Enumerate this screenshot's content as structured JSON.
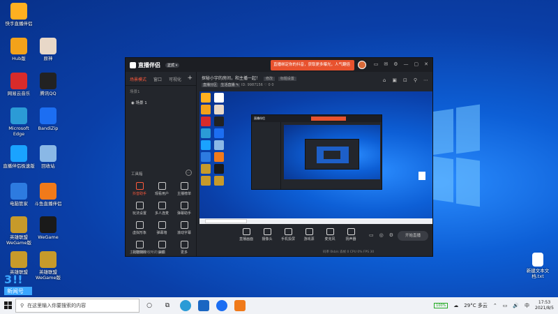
{
  "desktop": {
    "icons": [
      {
        "label": "快手直播伴侣",
        "color": "#ffb020"
      },
      {
        "label": "Hub版",
        "color": "#f3a21a"
      },
      {
        "label": "原神",
        "color": "#e8d8c8"
      },
      {
        "label": "网易云音乐",
        "color": "#d82b2b"
      },
      {
        "label": "腾讯QQ",
        "color": "#222222"
      },
      {
        "label": "Microsoft Edge",
        "color": "#2b9bd6"
      },
      {
        "label": "BandiZip",
        "color": "#1c6ef2"
      },
      {
        "label": "直播伴侣极速版",
        "color": "#1aa3ff"
      },
      {
        "label": "回收站",
        "color": "#8ab8e6"
      },
      {
        "label": "电脑管家",
        "color": "#2d7be0"
      },
      {
        "label": "斗鱼直播伴侣",
        "color": "#f07a1a"
      },
      {
        "label": "英雄联盟WeGame版",
        "color": "#c79a2a"
      },
      {
        "label": "WeGame",
        "color": "#1a1a1a"
      },
      {
        "label": "英雄联盟",
        "color": "#c79a2a"
      },
      {
        "label": "英雄联盟WeGame版",
        "color": "#c79a2a"
      }
    ],
    "right_file": {
      "label": "新建文本文档.txt"
    },
    "watermark_text": "新闻号"
  },
  "app": {
    "brand": "直播伴侣",
    "version": "正式 ▾",
    "banner": "直播绑定你的抖音，获取更多曝光，人气翻倍",
    "window_controls": [
      "▭",
      "✉",
      "⚙",
      "—",
      "▢",
      "✕"
    ],
    "sidebar": {
      "tabs": [
        "场景模式",
        "窗口",
        "可视化"
      ],
      "plus": "+",
      "scene_hint": "场景1",
      "scene_item": "◉ 场景 1",
      "tools_header": "工具箱",
      "tools": [
        {
          "label": "抖音助手",
          "red": true
        },
        {
          "label": "观看用户",
          "red": false
        },
        {
          "label": "主播榜单",
          "red": false
        },
        {
          "label": "玩法设置",
          "red": false
        },
        {
          "label": "多人连麦",
          "red": false
        },
        {
          "label": "弹幕助手",
          "red": false
        },
        {
          "label": "虚拟形象",
          "red": false
        },
        {
          "label": "弹幕墙",
          "red": false
        },
        {
          "label": "滚动字幕",
          "red": false
        },
        {
          "label": "礼物特效",
          "red": false
        },
        {
          "label": "美颜",
          "red": false
        },
        {
          "label": "更多",
          "red": false
        }
      ],
      "footer": "主播直播中收听的音频"
    },
    "live": {
      "title": "探秘小宇的房间，和主播一起！",
      "title_tag": "修改",
      "title_tag2": "标题设置",
      "meta_chip1": "直播分区",
      "meta_chip2": "生活直播 ✎",
      "meta_id": "ID: 9987156",
      "meta_fans": "♡ 0",
      "meta_count": "0"
    },
    "right_tools": [
      "⌂",
      "▣",
      "⊡",
      "⚲",
      "⋯"
    ],
    "bottom": {
      "items": [
        "直播画面",
        "摄像头",
        "手机投屏",
        "游戏源",
        "麦克风",
        "扬声器"
      ],
      "right_icons": [
        "▭",
        "◎",
        "⚙"
      ],
      "start_button": "开始直播",
      "status": "码率 0kb/s   丢帧 0   CPU 0%   FPS 30"
    }
  },
  "taskbar": {
    "search_placeholder": "在这里输入你要搜索的内容",
    "weather": "29°C 多云",
    "time": "17:53",
    "date": "2021/8/5",
    "battery": "100%",
    "tray_icons": [
      "⌃",
      "☁",
      "▭",
      "🔊",
      "中"
    ]
  }
}
